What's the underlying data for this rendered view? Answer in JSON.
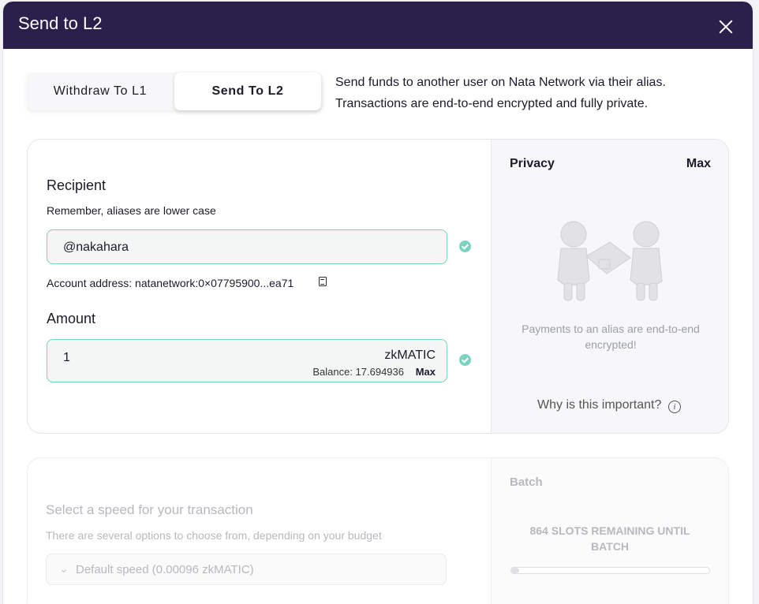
{
  "modal": {
    "title": "Send to L2"
  },
  "tabs": [
    {
      "label": "Withdraw To L1",
      "active": false
    },
    {
      "label": "Send To L2",
      "active": true
    }
  ],
  "description": "Send funds to another user on Nata Network via their alias. Transactions are end-to-end encrypted and fully private.",
  "recipient": {
    "label": "Recipient",
    "hint": "Remember, aliases are lower case",
    "value": "@nakahara",
    "account_address": "Account address: natanetwork:0×07795900...ea71"
  },
  "amount": {
    "label": "Amount",
    "value": "1",
    "currency": "zkMATIC",
    "balance": "Balance: 17.694936",
    "max_label": "Max"
  },
  "privacy": {
    "title": "Privacy",
    "level": "Max",
    "text": "Payments to an alias are end-to-end encrypted!",
    "why": "Why is this important?"
  },
  "speed": {
    "title": "Select a speed for your transaction",
    "hint": "There are several options to choose from, depending on your budget",
    "selected": "Default speed (0.00096 zkMATIC)"
  },
  "batch": {
    "title": "Batch",
    "remaining": "864 SLOTS REMAINING UNTIL BATCH",
    "progress": 0.04
  },
  "colors": {
    "header": "#2b1f4b",
    "accent": "#7ad3bd"
  }
}
